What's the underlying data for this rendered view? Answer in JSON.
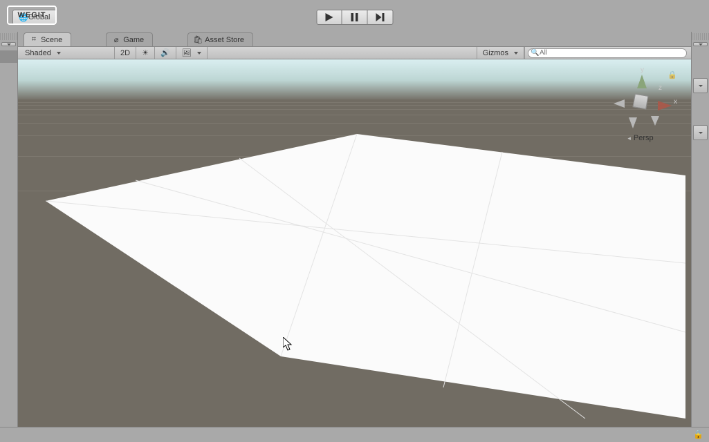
{
  "topbar": {
    "global_label": "Global",
    "overlay_label": "WEGIT"
  },
  "play_controls": {
    "play": "Play",
    "pause": "Pause",
    "step": "Step"
  },
  "tabs": {
    "scene": "Scene",
    "game": "Game",
    "asset_store": "Asset Store"
  },
  "scene_toolbar": {
    "shading_mode": "Shaded",
    "mode_2d": "2D",
    "gizmos_label": "Gizmos",
    "search_placeholder": "All"
  },
  "gizmo": {
    "x": "x",
    "y": "y",
    "z": "z",
    "projection": "Persp"
  }
}
